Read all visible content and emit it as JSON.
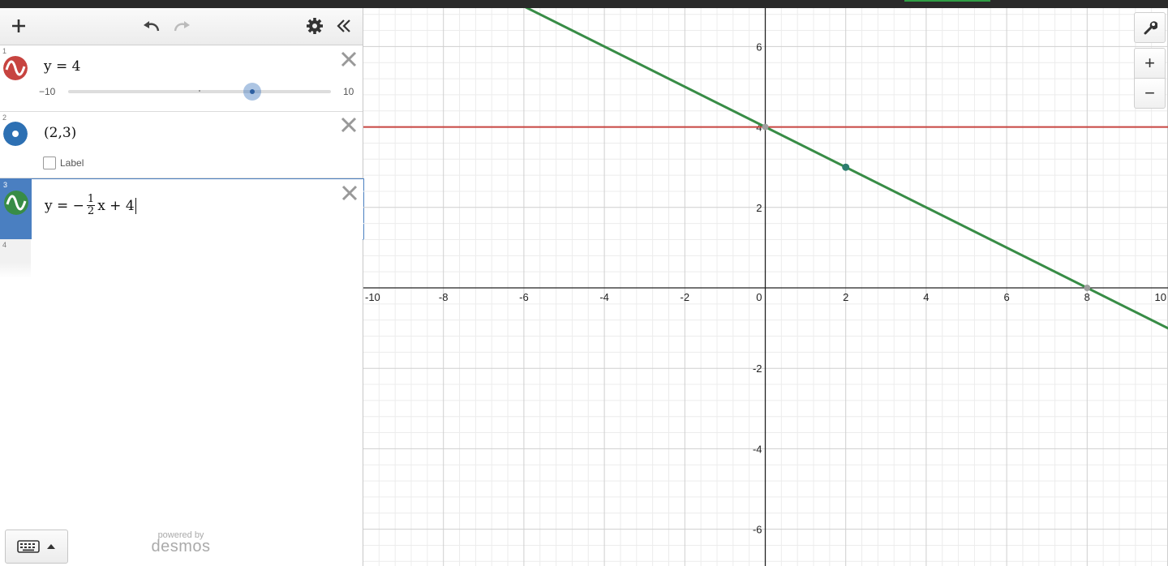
{
  "toolbar": {
    "add_icon": "plus-icon",
    "undo_icon": "undo-icon",
    "redo_icon": "redo-icon",
    "settings_icon": "gear-icon",
    "collapse_icon": "double-chevron-left-icon"
  },
  "expressions": [
    {
      "index": "1",
      "color": "#c74440",
      "type": "curve",
      "latex_text": "y = 4",
      "slider": {
        "min_label": "−10",
        "max_label": "10",
        "min": -10,
        "max": 10,
        "value": 4
      }
    },
    {
      "index": "2",
      "color": "#2d70b3",
      "type": "point",
      "latex_text": "(2,3)",
      "label_checkbox": {
        "text": "Label",
        "checked": false
      }
    },
    {
      "index": "3",
      "color": "#388c46",
      "type": "curve",
      "lhs": "y = −",
      "frac_num": "1",
      "frac_den": "2",
      "rhs": "x + 4"
    },
    {
      "index": "4"
    }
  ],
  "footer": {
    "powered_by": "powered by",
    "brand": "desmos",
    "keyboard_icon": "keyboard-icon",
    "caret_icon": "caret-up-icon"
  },
  "graph_controls": {
    "wrench_icon": "wrench-icon",
    "zoom_in": "+",
    "zoom_out": "−"
  },
  "graph": {
    "x_range": [
      -10,
      10
    ],
    "y_range": [
      -7,
      7
    ],
    "grid": true,
    "x_tick_labels": [
      "-10",
      "-8",
      "-6",
      "-4",
      "-2",
      "0",
      "2",
      "4",
      "6",
      "8",
      "10"
    ],
    "y_tick_labels": [
      "6",
      "4",
      "2",
      "-2",
      "-4",
      "-6"
    ],
    "lines": [
      {
        "equation": "y = 4",
        "color": "#c74440",
        "slope": 0,
        "intercept": 4
      },
      {
        "equation": "y = -1/2 x + 4",
        "color": "#388c46",
        "slope": -0.5,
        "intercept": 4
      }
    ],
    "points": [
      {
        "x": 2,
        "y": 3,
        "color": "#2d7d6e"
      }
    ],
    "intercept_points": [
      {
        "x": 0,
        "y": 4
      },
      {
        "x": 8,
        "y": 0
      }
    ]
  }
}
